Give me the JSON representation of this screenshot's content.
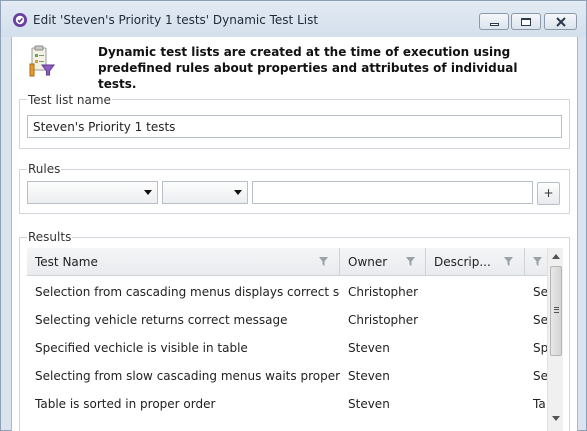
{
  "window": {
    "title": "Edit 'Steven's Priority 1 tests' Dynamic Test List"
  },
  "header": {
    "description": "Dynamic test lists are created at the time of execution using predefined rules about properties and attributes of individual tests."
  },
  "test_list_name": {
    "label": "Test list name",
    "value": "Steven's Priority 1 tests"
  },
  "rules": {
    "label": "Rules",
    "field_value": "",
    "operator_value": "",
    "criteria_value": "",
    "add_label": "+"
  },
  "results": {
    "label": "Results",
    "columns": [
      "Test Name",
      "Owner",
      "Descrip...",
      ""
    ],
    "rows": [
      [
        "Selection from cascading menus displays correct selection",
        "Christopher",
        "",
        "Se"
      ],
      [
        "Selecting vehicle returns correct message",
        "Christopher",
        "",
        "Se"
      ],
      [
        "Specified vechicle is visible in table",
        "Steven",
        "",
        "Sp"
      ],
      [
        "Selecting from slow cascading menus waits properly",
        "Steven",
        "",
        "Se"
      ],
      [
        "Table is sorted in proper order",
        "Steven",
        "",
        "Ta"
      ]
    ]
  },
  "icons": {
    "title": "gear-badge-icon",
    "header": "dynamic-list-icon",
    "filter": "filter-funnel-icon"
  },
  "colors": {
    "title_icon": "#6b3fa0",
    "window_frame": "#dbe4ee"
  }
}
